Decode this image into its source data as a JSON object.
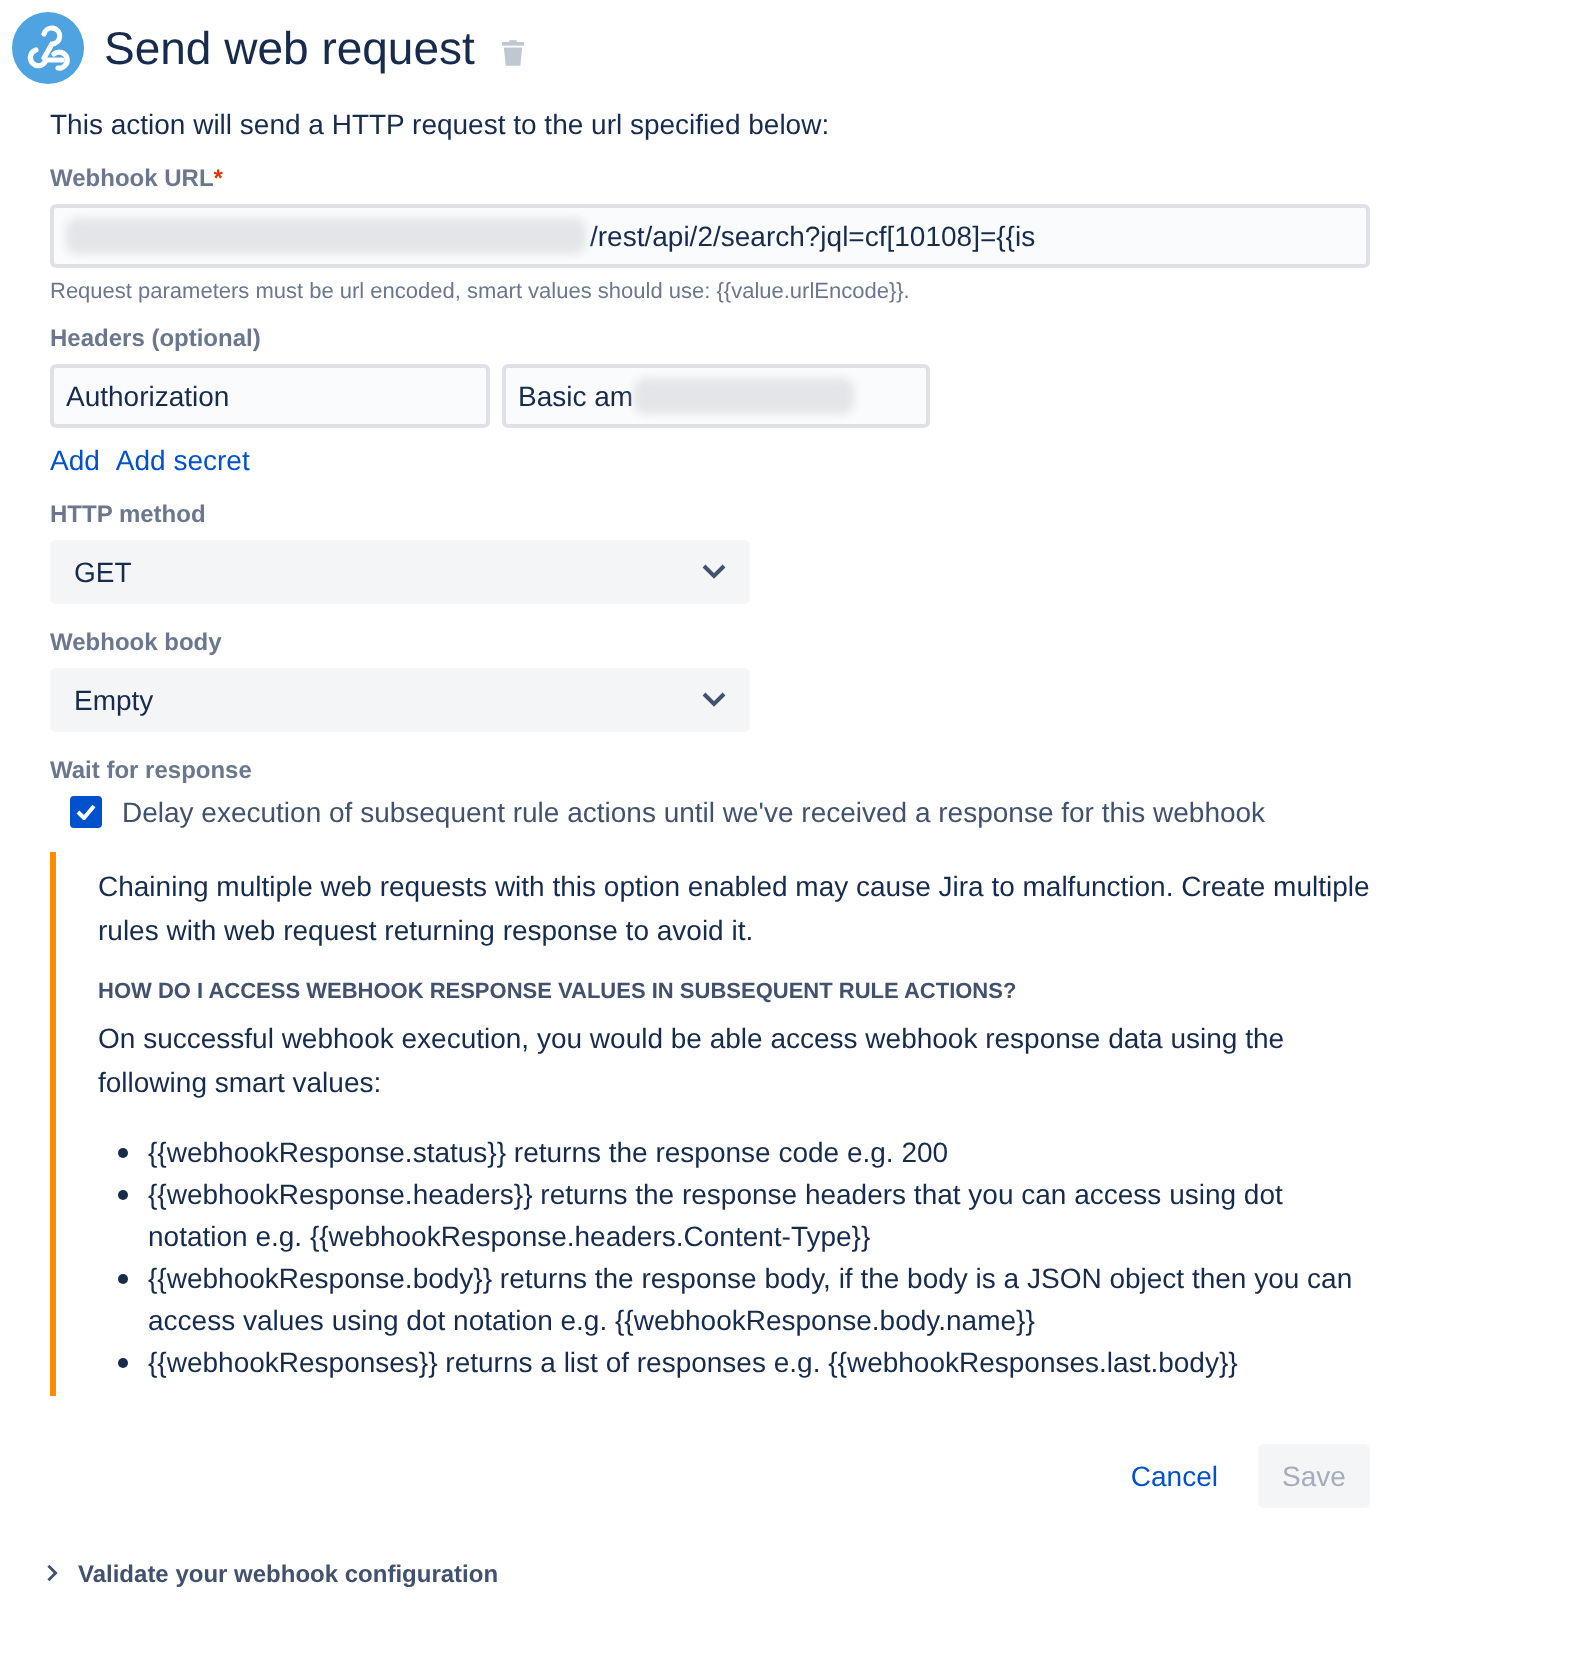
{
  "header": {
    "title": "Send web request"
  },
  "description": "This action will send a HTTP request to the url specified below:",
  "url_field": {
    "label": "Webhook URL",
    "required_mark": "*",
    "value": "/rest/api/2/search?jql=cf[10108]={{is",
    "redacted": true,
    "help": "Request parameters must be url encoded, smart values should use: {{value.urlEncode}}."
  },
  "headers": {
    "label": "Headers (optional)",
    "name": "Authorization",
    "value": "Basic am",
    "value_redacted": true,
    "links": [
      "Add",
      "Add secret"
    ]
  },
  "http_method": {
    "label": "HTTP method",
    "value": "GET"
  },
  "webhook_body": {
    "label": "Webhook body",
    "value": "Empty"
  },
  "wait": {
    "label": "Wait for response",
    "checkbox_label": "Delay execution of subsequent rule actions until we've received a response for this webhook",
    "checked": true
  },
  "warning": {
    "text": "Chaining multiple web requests with this option enabled may cause Jira to malfunction. Create multiple rules with web request returning response to avoid it.",
    "heading": "HOW DO I ACCESS WEBHOOK RESPONSE VALUES IN SUBSEQUENT RULE ACTIONS?",
    "intro": "On successful webhook execution, you would be able access webhook response data using the following smart values:",
    "items": [
      "{{webhookResponse.status}} returns the response code e.g. 200",
      "{{webhookResponse.headers}} returns the response headers that you can access using dot notation e.g. {{webhookResponse.headers.Content-Type}}",
      "{{webhookResponse.body}} returns the response body, if the body is a JSON object then you can access values using dot notation e.g. {{webhookResponse.body.name}}",
      "{{webhookResponses}} returns a list of responses e.g. {{webhookResponses.last.body}}"
    ]
  },
  "buttons": [
    {
      "label": "Cancel",
      "kind": "link",
      "disabled": false
    },
    {
      "label": "Save",
      "kind": "primary",
      "disabled": true
    }
  ],
  "validate": {
    "label": "Validate your webhook configuration",
    "expanded": false
  }
}
